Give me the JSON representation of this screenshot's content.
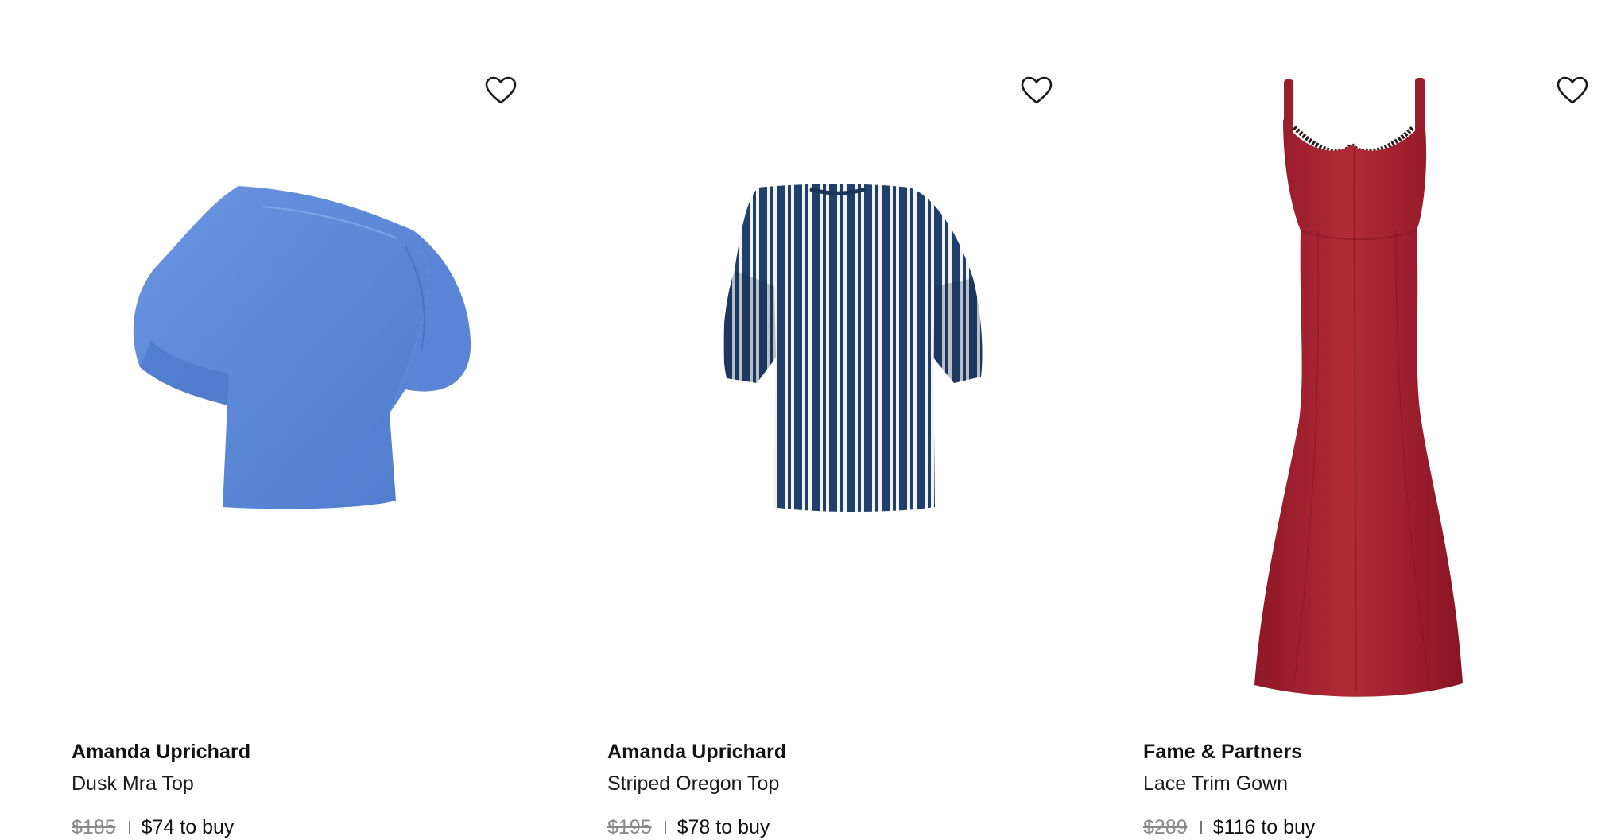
{
  "products": [
    {
      "brand": "Amanda Uprichard",
      "name": "Dusk Mra Top",
      "retail_price": "$185",
      "buy_price": "$74 to buy",
      "garment_color": "#5b86d6",
      "image": "one-shoulder-puff-sleeve-top"
    },
    {
      "brand": "Amanda Uprichard",
      "name": "Striped Oregon Top",
      "retail_price": "$195",
      "buy_price": "$78 to buy",
      "garment_color": "#22416e",
      "image": "striped-short-sleeve-top"
    },
    {
      "brand": "Fame & Partners",
      "name": "Lace Trim Gown",
      "retail_price": "$289",
      "buy_price": "$116 to buy",
      "garment_color": "#a3202e",
      "image": "sleeveless-mermaid-gown"
    }
  ],
  "icons": {
    "favorite": "heart-outline-icon"
  }
}
